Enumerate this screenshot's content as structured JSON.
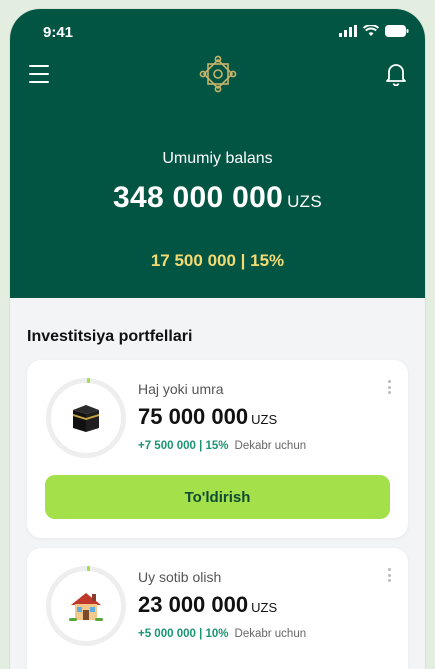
{
  "status_bar": {
    "time": "9:41"
  },
  "header": {
    "balance_label": "Umumiy balans",
    "balance_amount": "348 000 000",
    "balance_currency": "UZS",
    "profit": "17 500 000 | 15%",
    "colors": {
      "background": "#035543",
      "profit": "#f3da73"
    }
  },
  "portfolios": {
    "title": "Investitsiya portfellari",
    "items": [
      {
        "icon": "kaaba-icon",
        "title": "Haj yoki umra",
        "amount": "75 000 000",
        "currency": "UZS",
        "gain": "+7 500 000 | 15%",
        "period": "Dekabr uchun",
        "button_label": "To'ldirish"
      },
      {
        "icon": "house-icon",
        "title": "Uy sotib olish",
        "amount": "23 000 000",
        "currency": "UZS",
        "gain": "+5 000 000 | 10%",
        "period": "Dekabr uchun"
      }
    ]
  },
  "colors": {
    "accent_button": "#a3e049",
    "gain_text": "#1b9474"
  }
}
